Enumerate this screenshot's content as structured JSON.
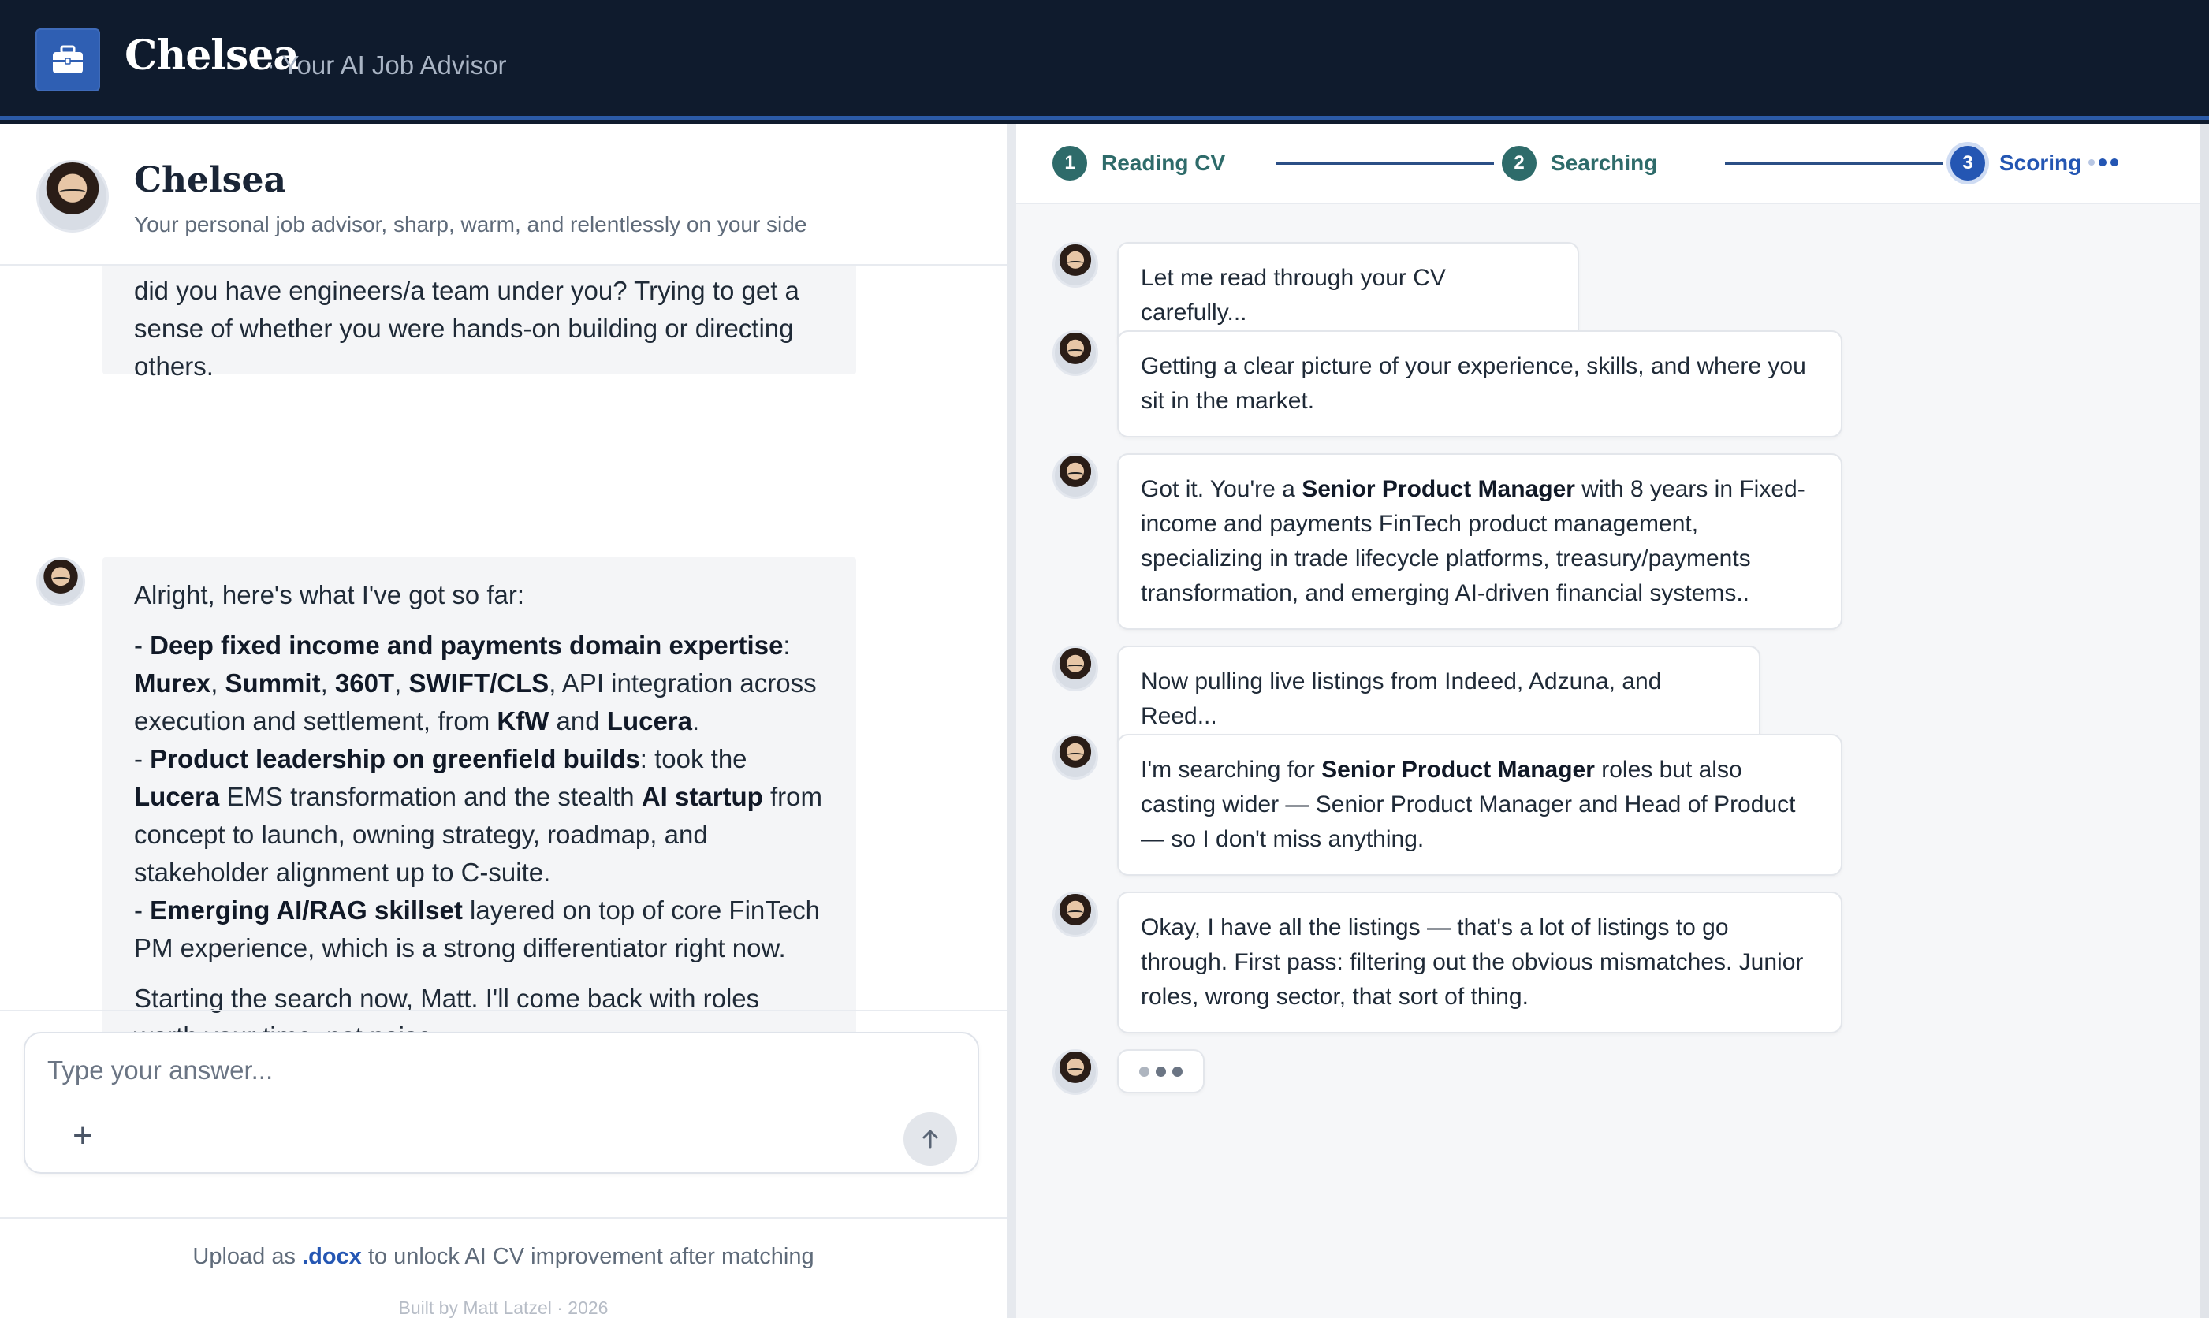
{
  "app": {
    "name": "Chelsea",
    "tagline": "· Your AI Job Advisor",
    "icon": "briefcase-icon"
  },
  "advisor": {
    "name": "Chelsea",
    "subtitle": "Your personal job advisor, sharp, warm, and relentlessly on your side"
  },
  "chat": {
    "message_1_text": "did you have engineers/a team under you? Trying to get a sense of whether you were hands-on building or directing others.",
    "message_2": {
      "intro": "Alright, here's what I've got so far:",
      "b1_dash": "- ",
      "b1_bold": "Deep fixed income and payments domain expertise",
      "b1_colon": ": ",
      "b1_k1": "Murex",
      "b1_sep1": ", ",
      "b1_k2": "Summit",
      "b1_sep2": ", ",
      "b1_k3": "360T",
      "b1_sep3": ", ",
      "b1_k4": "SWIFT/CLS",
      "b1_rest": ", API integration across execution and settlement, from ",
      "b1_k5": "KfW",
      "b1_and": " and ",
      "b1_k6": "Lucera",
      "b1_end": ".",
      "b2_dash": "- ",
      "b2_bold": "Product leadership on greenfield builds",
      "b2_mid": ": took the ",
      "b2_k1": "Lucera",
      "b2_mid2": " EMS transformation and the stealth ",
      "b2_k2": "AI startup",
      "b2_rest": " from concept to launch, owning strategy, roadmap, and stakeholder alignment up to C-suite.",
      "b3_dash": "- ",
      "b3_bold": "Emerging AI/RAG skillset",
      "b3_rest": " layered on top of core FinTech PM experience, which is a strong differentiator right now.",
      "closing": "Starting the search now, Matt. I'll come back with roles worth your time, not noise."
    }
  },
  "composer": {
    "placeholder": "Type your answer...",
    "value": "",
    "plus_label": "+"
  },
  "footer": {
    "upload_pre": "Upload as ",
    "upload_ext": ".docx",
    "upload_post": " to unlock AI CV improvement after matching",
    "built_by": "Built by Matt Latzel · 2026"
  },
  "steps": [
    {
      "num": "1",
      "label": "Reading CV",
      "state": "done"
    },
    {
      "num": "2",
      "label": "Searching",
      "state": "done"
    },
    {
      "num": "3",
      "label": "Scoring",
      "state": "active"
    }
  ],
  "feed": {
    "m1": "Let me read through your CV carefully...",
    "m2": "Getting a clear picture of your experience, skills, and where you sit in the market.",
    "m3_pre": "Got it. You're a ",
    "m3_bold": "Senior Product Manager",
    "m3_post": " with 8 years in Fixed-income and payments FinTech product management, specializing in trade lifecycle platforms, treasury/payments transformation, and emerging AI-driven financial systems..",
    "m4": "Now pulling live listings from Indeed, Adzuna, and Reed...",
    "m5_pre": "I'm searching for ",
    "m5_bold": "Senior Product Manager",
    "m5_post": " roles but also casting wider — Senior Product Manager and Head of Product — so I don't miss anything.",
    "m6": "Okay, I have all the listings — that's a lot of listings to go through. First pass: filtering out the obvious mismatches. Junior roles, wrong sector, that sort of thing."
  },
  "colors": {
    "header_bg": "#0f1b2d",
    "accent_blue": "#2456b3",
    "step_done": "#2e6b6a"
  }
}
